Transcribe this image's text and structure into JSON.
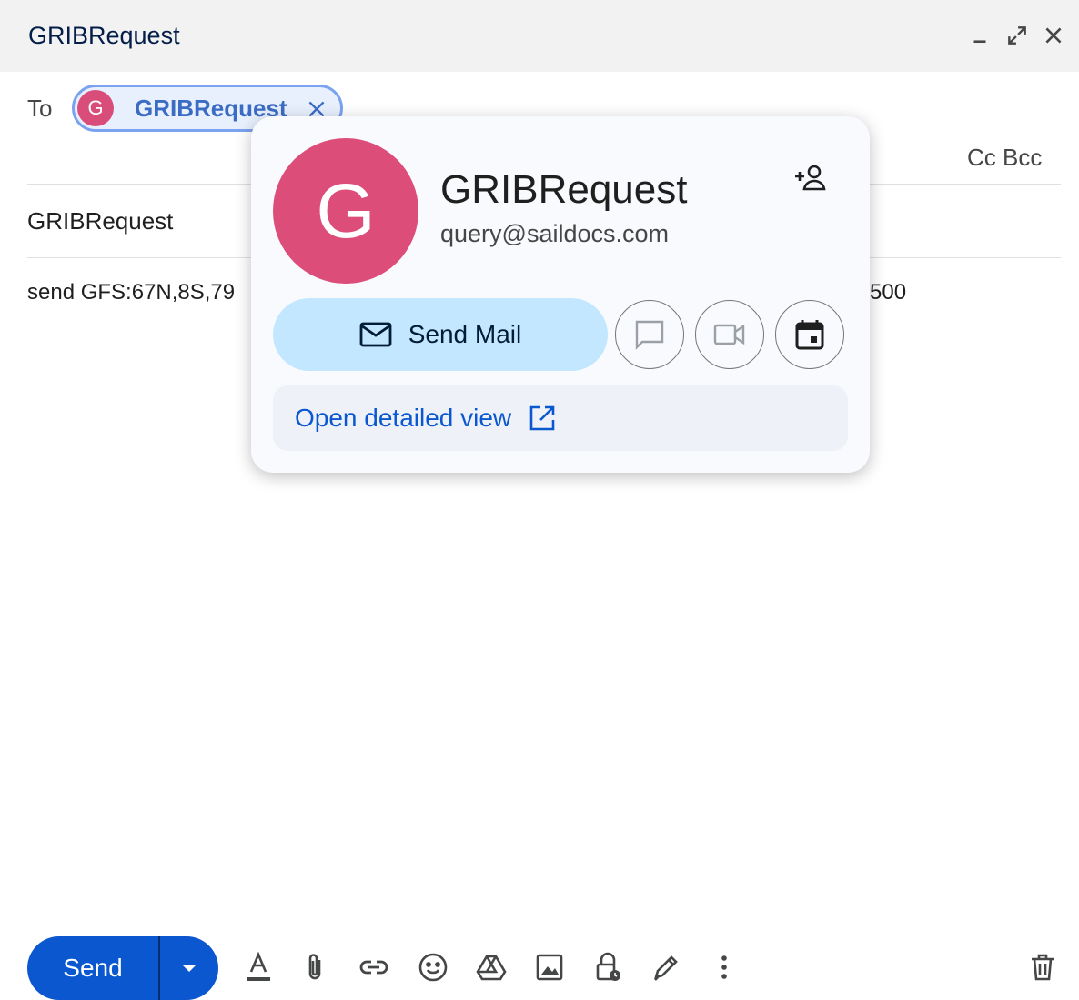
{
  "window": {
    "title": "GRIBRequest",
    "minimize_icon": "minimize-icon",
    "expand_icon": "expand-icon",
    "close_icon": "close-icon"
  },
  "recipients": {
    "to_label": "To",
    "chip": {
      "avatar_letter": "G",
      "name": "GRIBRequest",
      "avatar_color": "#d94d7a"
    },
    "cc_bcc_label": "Cc Bcc"
  },
  "subject": "GRIBRequest",
  "body": {
    "visible_left": "send GFS:67N,8S,79",
    "visible_right": "500"
  },
  "contact_card": {
    "avatar_letter": "G",
    "name": "GRIBRequest",
    "email": "query@saildocs.com",
    "send_mail_label": "Send Mail",
    "open_detailed_view_label": "Open detailed view",
    "avatar_color": "#dc4d7a",
    "accent_color": "#0b57d0"
  },
  "toolbar": {
    "send_label": "Send",
    "send_color": "#0b57d0",
    "icons": [
      "text-format-icon",
      "attach-icon",
      "link-icon",
      "emoji-icon",
      "drive-icon",
      "photo-icon",
      "confidential-icon",
      "signature-icon",
      "more-options-icon",
      "trash-icon"
    ]
  }
}
